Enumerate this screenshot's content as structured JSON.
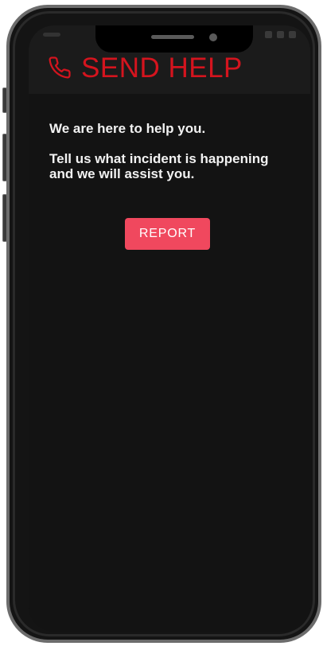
{
  "header": {
    "title": "SEND HELP",
    "icon": "phone-icon"
  },
  "content": {
    "line1": "We are here to help you.",
    "line2": "Tell us what incident is happening and we will assist you."
  },
  "actions": {
    "report_label": "REPORT"
  },
  "colors": {
    "accent": "#d4141e",
    "button": "#f0485e",
    "background": "#131313",
    "header_bg": "#1b1b1b"
  }
}
